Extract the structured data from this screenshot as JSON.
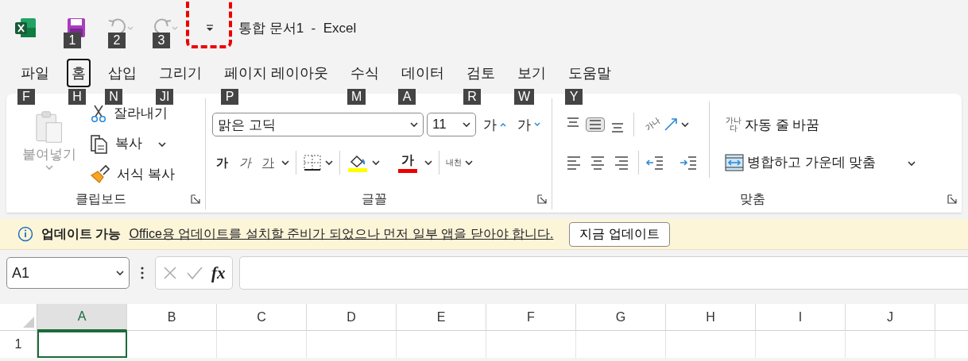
{
  "title_bar": {
    "qat": [
      {
        "kind": "save",
        "keytip": "1",
        "disabled": false,
        "highlighted": false
      },
      {
        "kind": "undo",
        "keytip": "2",
        "disabled": true,
        "highlighted": false
      },
      {
        "kind": "redo",
        "keytip": "3",
        "disabled": true,
        "highlighted": false
      },
      {
        "kind": "customize",
        "highlighted": true
      }
    ],
    "title": "통합 문서1  -  Excel"
  },
  "tabs": [
    {
      "label": "파일",
      "keytip": "F",
      "selected": false
    },
    {
      "label": "홈",
      "keytip": "H",
      "selected": true
    },
    {
      "label": "삽입",
      "keytip": "N",
      "selected": false
    },
    {
      "label": "그리기",
      "keytip": "JI",
      "selected": false
    },
    {
      "label": "페이지 레이아웃",
      "keytip": "P",
      "selected": false
    },
    {
      "label": "수식",
      "keytip": "M",
      "selected": false
    },
    {
      "label": "데이터",
      "keytip": "A",
      "selected": false
    },
    {
      "label": "검토",
      "keytip": "R",
      "selected": false
    },
    {
      "label": "보기",
      "keytip": "W",
      "selected": false
    },
    {
      "label": "도움말",
      "keytip": "Y",
      "selected": false
    }
  ],
  "ribbon": {
    "clipboard": {
      "label": "클립보드",
      "paste": {
        "label": "붙여넣기",
        "disabled": true
      },
      "items": [
        {
          "kind": "cut",
          "label": "잘라내기",
          "dropdown": false
        },
        {
          "kind": "copy",
          "label": "복사",
          "dropdown": true
        },
        {
          "kind": "painter",
          "label": "서식 복사",
          "dropdown": false
        }
      ]
    },
    "font": {
      "label": "글꼴",
      "font_name": "맑은 고딕",
      "font_size": "11",
      "grow": "가",
      "shrink": "가",
      "bold": "가",
      "italic": "가",
      "underline": "가",
      "font_color": "가",
      "phonetic": "내천"
    },
    "alignment": {
      "label": "맞춤",
      "vertical": [
        {
          "kind": "top",
          "selected": false
        },
        {
          "kind": "middle",
          "selected": true
        },
        {
          "kind": "bottom",
          "selected": false
        }
      ],
      "horizontal": [
        {
          "kind": "left",
          "selected": false
        },
        {
          "kind": "center",
          "selected": false
        },
        {
          "kind": "right",
          "selected": false
        }
      ],
      "orientation": "가나",
      "wrap": {
        "icon_text": "가나다",
        "label": "자동 줄 바꿈"
      },
      "merge": {
        "label": "병합하고 가운데 맞춤"
      }
    }
  },
  "notification": {
    "title": "업데이트 가능",
    "message": "Office용 업데이트를 설치할 준비가 되었으나 먼저 일부 앱을 닫아야 합니다.",
    "button": "지금 업데이트"
  },
  "formula_bar": {
    "name_box": "A1",
    "fx": "fx"
  },
  "grid": {
    "columns": [
      {
        "label": "A",
        "selected": true
      },
      {
        "label": "B",
        "selected": false
      },
      {
        "label": "C",
        "selected": false
      },
      {
        "label": "D",
        "selected": false
      },
      {
        "label": "E",
        "selected": false
      },
      {
        "label": "F",
        "selected": false
      },
      {
        "label": "G",
        "selected": false
      },
      {
        "label": "H",
        "selected": false
      },
      {
        "label": "I",
        "selected": false
      },
      {
        "label": "J",
        "selected": false
      }
    ],
    "rows": [
      {
        "header": "1",
        "cells": [
          {
            "selected": true
          },
          {
            "selected": false
          },
          {
            "selected": false
          },
          {
            "selected": false
          },
          {
            "selected": false
          },
          {
            "selected": false
          },
          {
            "selected": false
          },
          {
            "selected": false
          },
          {
            "selected": false
          },
          {
            "selected": false
          }
        ]
      }
    ]
  }
}
